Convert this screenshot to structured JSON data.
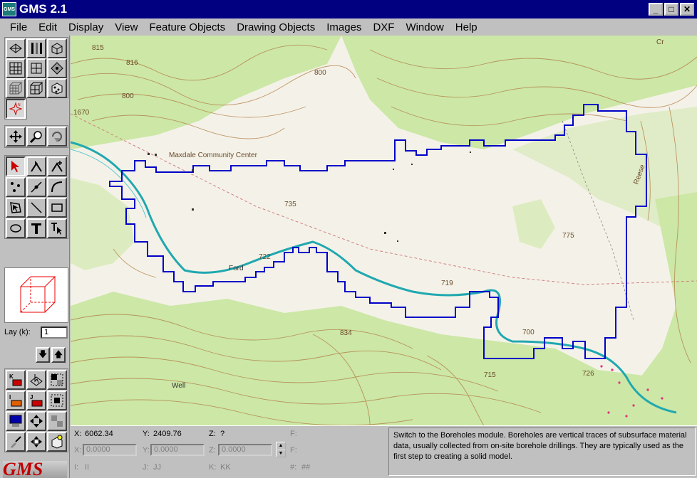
{
  "window": {
    "title": "GMS 2.1",
    "icon_label": "GMS",
    "minimize": "_",
    "maximize": "□",
    "close": "✕"
  },
  "menu": [
    "File",
    "Edit",
    "Display",
    "View",
    "Feature Objects",
    "Drawing Objects",
    "Images",
    "DXF",
    "Window",
    "Help"
  ],
  "map_labels": {
    "community_center": "Maxdale Community Center",
    "road_1670": "1670",
    "c815": "815",
    "c816": "816",
    "c800a": "800",
    "c800b": "800",
    "c735": "735",
    "c722": "722",
    "c719": "719",
    "c700": "700",
    "c726": "726",
    "c834": "834",
    "c715": "715",
    "c775": "775",
    "reese": "Reese",
    "well": "Well",
    "ford": "Ford",
    "cr": "Cr"
  },
  "sidebar": {
    "layer_label": "Lay (k):",
    "layer_value": "1",
    "down_arrow": "🡇",
    "up_arrow": "🡅",
    "logo_text": "GMS"
  },
  "status": {
    "x_label": "X:",
    "x_value": "6062.34",
    "y_label": "Y:",
    "y_value": "2409.76",
    "z_label": "Z:",
    "z_value": "?",
    "f_label": "F:",
    "x2_label": "X:",
    "x2_value": "0.0000",
    "y2_label": "Y:",
    "y2_value": "0.0000",
    "z2_label": "Z:",
    "z2_value": "0.0000",
    "f2_label": "F:",
    "i_label": "I:",
    "i_value": "II",
    "j_label": "J:",
    "j_value": "JJ",
    "k_label": "K:",
    "k_value": "KK",
    "hash_label": "#:",
    "hash_value": "##",
    "help_text": "Switch to the Boreholes module.  Boreholes are vertical traces of subsurface material data, usually collected from on-site borehole drillings.  They are typically used as the first step to creating a solid model."
  },
  "colors": {
    "boundary": "#0000c8",
    "river": "#20a8b0",
    "contour": "#a8703a",
    "vegetation": "#c8e8a0",
    "title_bar": "#000080"
  }
}
